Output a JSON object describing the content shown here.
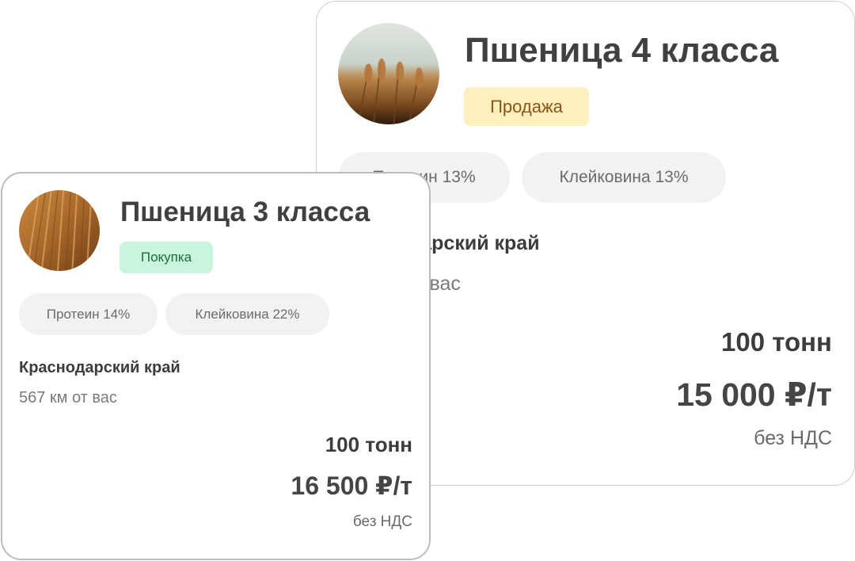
{
  "listings": [
    {
      "title": "Пшеница 3 класса",
      "deal_type": "Покупка",
      "deal_type_bg": "#c9f5dc",
      "deal_type_color": "#1f6b3f",
      "image": "wheat-field-photo",
      "chips": [
        "Протеин 14%",
        "Клейковина 22%"
      ],
      "region": "Краснодарский край",
      "distance": "567 км от вас",
      "quantity": "100 тонн",
      "price": "16 500 ₽/т",
      "vat": "без НДС"
    },
    {
      "title": "Пшеница 4 класса",
      "deal_type": "Продажа",
      "deal_type_bg": "#fdf0bd",
      "deal_type_color": "#8a5418",
      "image": "wheat-field-photo",
      "chips": [
        "Протеин 13%",
        "Клейковина 13%"
      ],
      "region": "Краснодарский край",
      "distance": "567 км от вас",
      "quantity": "100 тонн",
      "price": "15 000 ₽/т",
      "vat": "без НДС"
    }
  ]
}
